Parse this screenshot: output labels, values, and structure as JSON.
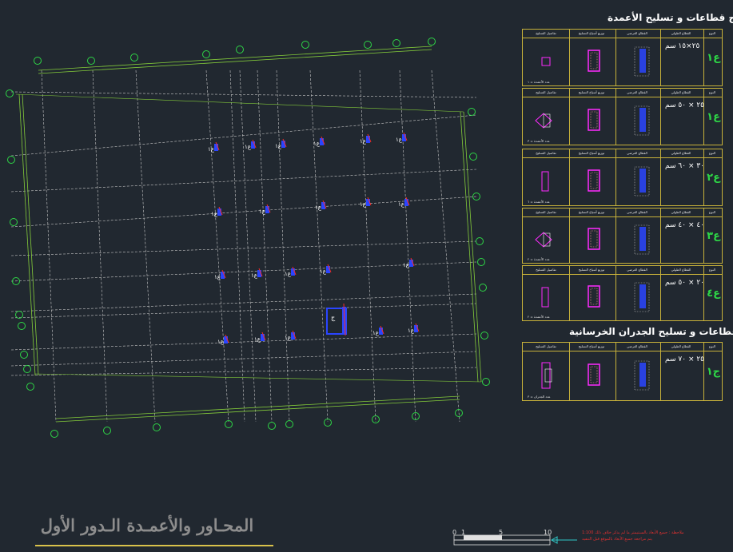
{
  "colors": {
    "background": "#212830",
    "grid": "#c9c9c9",
    "axis_bubble": "#2ed646",
    "dimension_line": "#84cc3a",
    "column_tag": "#ffffff",
    "column_blue": "#2a45ff",
    "column_red": "#ff2a2a",
    "table_border": "#c8b23a",
    "section_magenta": "#ff2aff",
    "scale_arrow": "#2fc7c7",
    "note_red": "#e03030"
  },
  "schedules": {
    "columns_title": "نماذج قطاعات و تسليح الأعمدة",
    "walls_title": "نماذج قطاعات و تسليح الجدران الخرسانية",
    "headers": [
      "تفاصيل التسليح",
      "توزيع أسياخ التسليح",
      "القطاع العرضي",
      "القطاع الطولي",
      "النوع"
    ],
    "rows": [
      {
        "mark": "ع١",
        "dimension": "٢٥×١٥ سم",
        "footer": "عدد الأعمدة = ١"
      },
      {
        "mark": "ع١",
        "dimension": "٢٥ × ٥٠ سم",
        "footer": "عدد الأعمدة = ٣"
      },
      {
        "mark": "ع٢",
        "dimension": "٣٠ × ٦٠ سم",
        "footer": "عدد الأعمدة = ٦"
      },
      {
        "mark": "ع٣",
        "dimension": "٤٠ × ٤٠ سم",
        "footer": "عدد الأعمدة = ٢"
      },
      {
        "mark": "ع٤",
        "dimension": "٢٠ × ٥٠ سم",
        "footer": "عدد الأعمدة = ٢"
      },
      {
        "mark": "ج١",
        "dimension": "٢٥ × ٧٠ سم",
        "footer": "عدد الجدران = ٣"
      }
    ]
  },
  "plan": {
    "column_tag": "ع١",
    "wall_tag": "ج"
  },
  "title_block": {
    "title": "المحـاور والأعمـدة الـدور الأول",
    "scale_labels": [
      "0",
      "1",
      "5",
      "10"
    ],
    "notes": [
      "ملاحظة : جميع الأبعاد بالسنتيمتر ما لم يذكر خلاف ذلك 1:100",
      "يتم مراجعة جميع الأبعاد بالموقع قبل التنفيذ"
    ]
  }
}
